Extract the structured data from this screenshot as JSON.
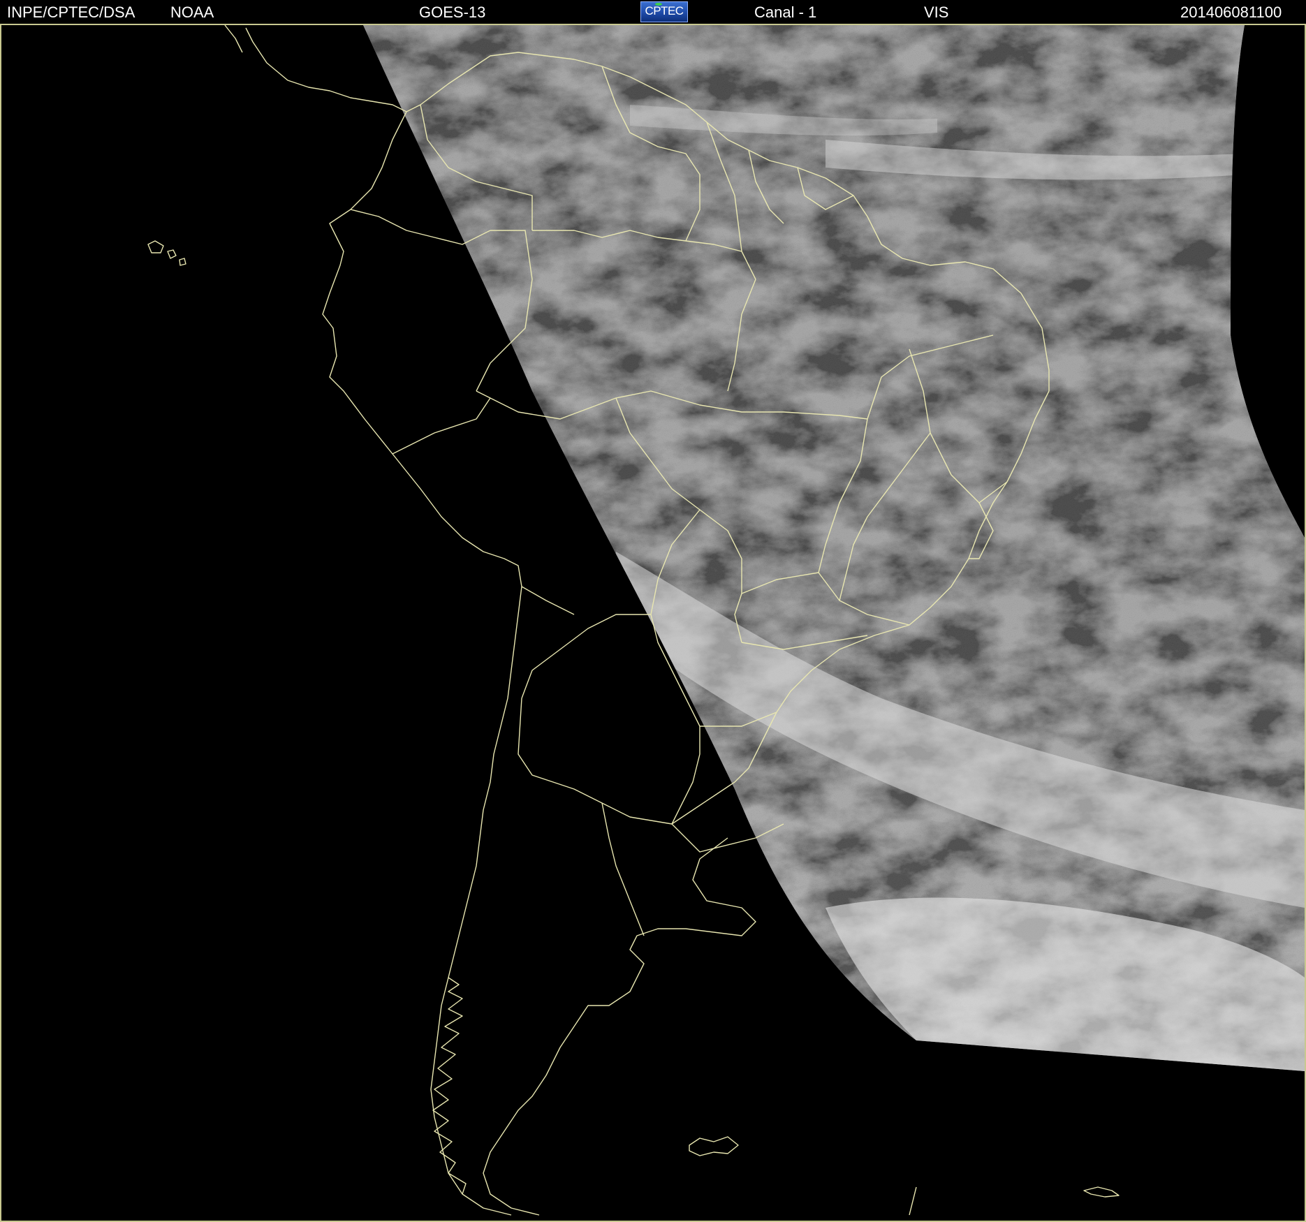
{
  "header": {
    "org": "INPE/CPTEC/DSA",
    "source": "NOAA",
    "satellite": "GOES-13",
    "logo": "CPTEC",
    "channel": "Canal - 1",
    "band": "VIS",
    "timestamp": "201406081100"
  },
  "colors": {
    "background": "#000000",
    "coastline": "#e8e6b0",
    "text": "#ffffff",
    "frame": "#c8c890"
  }
}
